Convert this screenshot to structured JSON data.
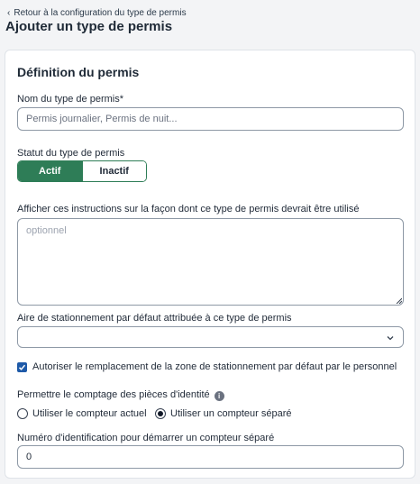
{
  "header": {
    "back_link": "Retour à la configuration du type de permis",
    "title": "Ajouter un type de permis"
  },
  "card": {
    "title": "Définition du permis",
    "name_field": {
      "label": "Nom du type de permis*",
      "placeholder": "Permis journalier, Permis de nuit...",
      "value": ""
    },
    "status": {
      "label": "Statut du type de permis",
      "options": [
        "Actif",
        "Inactif"
      ],
      "selected": "Actif"
    },
    "instructions": {
      "label": "Afficher ces instructions sur la façon dont ce type de permis devrait être utilisé",
      "placeholder": "optionnel",
      "value": ""
    },
    "default_area": {
      "label": "Aire de stationnement par défaut attribuée à ce type de permis",
      "value": ""
    },
    "allow_override": {
      "label": "Autoriser le remplacement de la zone de stationnement par défaut par le personnel",
      "checked": true
    },
    "id_counting": {
      "label": "Permettre le comptage des pièces d'identité",
      "options": [
        "Utiliser le compteur actuel",
        "Utiliser un compteur séparé"
      ],
      "selected": "Utiliser un compteur séparé"
    },
    "start_number": {
      "label": "Numéro d'identification pour démarrer un compteur séparé",
      "value": "0"
    }
  },
  "icons": [
    "chevron-left-icon",
    "chevron-down-icon",
    "check-icon",
    "info-icon"
  ],
  "colors": {
    "accent_green": "#2e7d57",
    "checkbox_blue": "#1e5aa8",
    "background": "#f3f4f6"
  }
}
